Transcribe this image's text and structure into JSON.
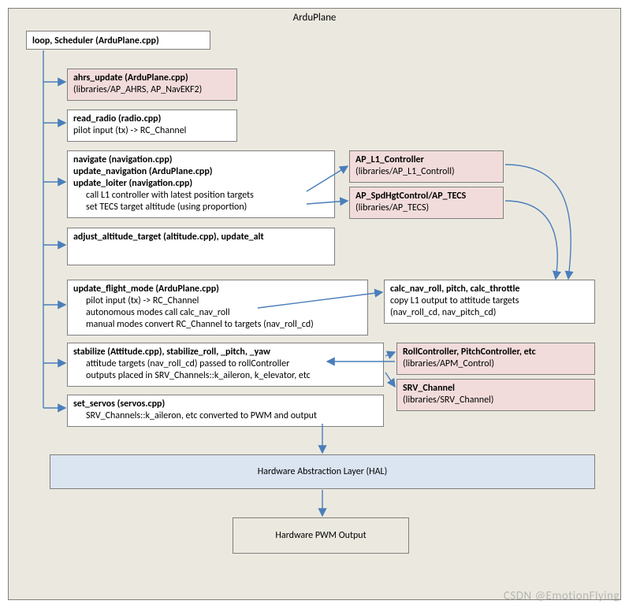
{
  "title": "ArduPlane",
  "loop": {
    "title": "loop, Scheduler (ArduPlane.cpp)"
  },
  "ahrs": {
    "title": "ahrs_update (ArduPlane.cpp)",
    "sub": "(libraries/AP_AHRS, AP_NavEKF2)"
  },
  "radio": {
    "title": "read_radio (radio.cpp)",
    "sub": "pilot input (tx) -> RC_Channel"
  },
  "nav": {
    "l1": "navigate (navigation.cpp)",
    "l2": "update_navigation (ArduPlane.cpp)",
    "l3": "update_loiter (navigation.cpp)",
    "d1": "call L1 controller with latest position targets",
    "d2": "set TECS target altitude (using proportion)"
  },
  "l1ctrl": {
    "title": "AP_L1_Controller",
    "sub": "(libraries/AP_L1_Controll)"
  },
  "tecs": {
    "title": "AP_SpdHgtControl/AP_TECS",
    "sub": "(libraries/AP_TECS)"
  },
  "alt": {
    "title": "adjust_altitude_target (altitude.cpp), update_alt"
  },
  "flight": {
    "title": "update_flight_mode (ArduPlane.cpp)",
    "d1": "pilot input (tx) -> RC_Channel",
    "d2": "autonomous modes call calc_nav_roll",
    "d3": "manual modes convert RC_Channel to targets (nav_roll_cd)"
  },
  "calc": {
    "title": "calc_nav_roll, pitch, calc_throttle",
    "d1": "copy L1 output to attitude targets",
    "d2": "(nav_roll_cd, nav_pitch_cd)"
  },
  "stab": {
    "title": "stabilize (Attitude.cpp), stabilize_roll, _pitch, _yaw",
    "d1": "attitude targets (nav_roll_cd) passed to rollController",
    "d2": "outputs placed in SRV_Channels::k_aileron, k_elevator, etc"
  },
  "rollpitch": {
    "title": "RollController, PitchController, etc",
    "sub": "(libraries/APM_Control)"
  },
  "srv": {
    "title": "SRV_Channel",
    "sub": "(libraries/SRV_Channel)"
  },
  "servos": {
    "title": "set_servos (servos.cpp)",
    "sub": "SRV_Channels::k_aileron, etc converted to PWM and output"
  },
  "hal": {
    "title": "Hardware Abstraction Layer (HAL)"
  },
  "pwm": {
    "title": "Hardware PWM Output"
  },
  "watermark": "CSDN @EmotionFlying"
}
